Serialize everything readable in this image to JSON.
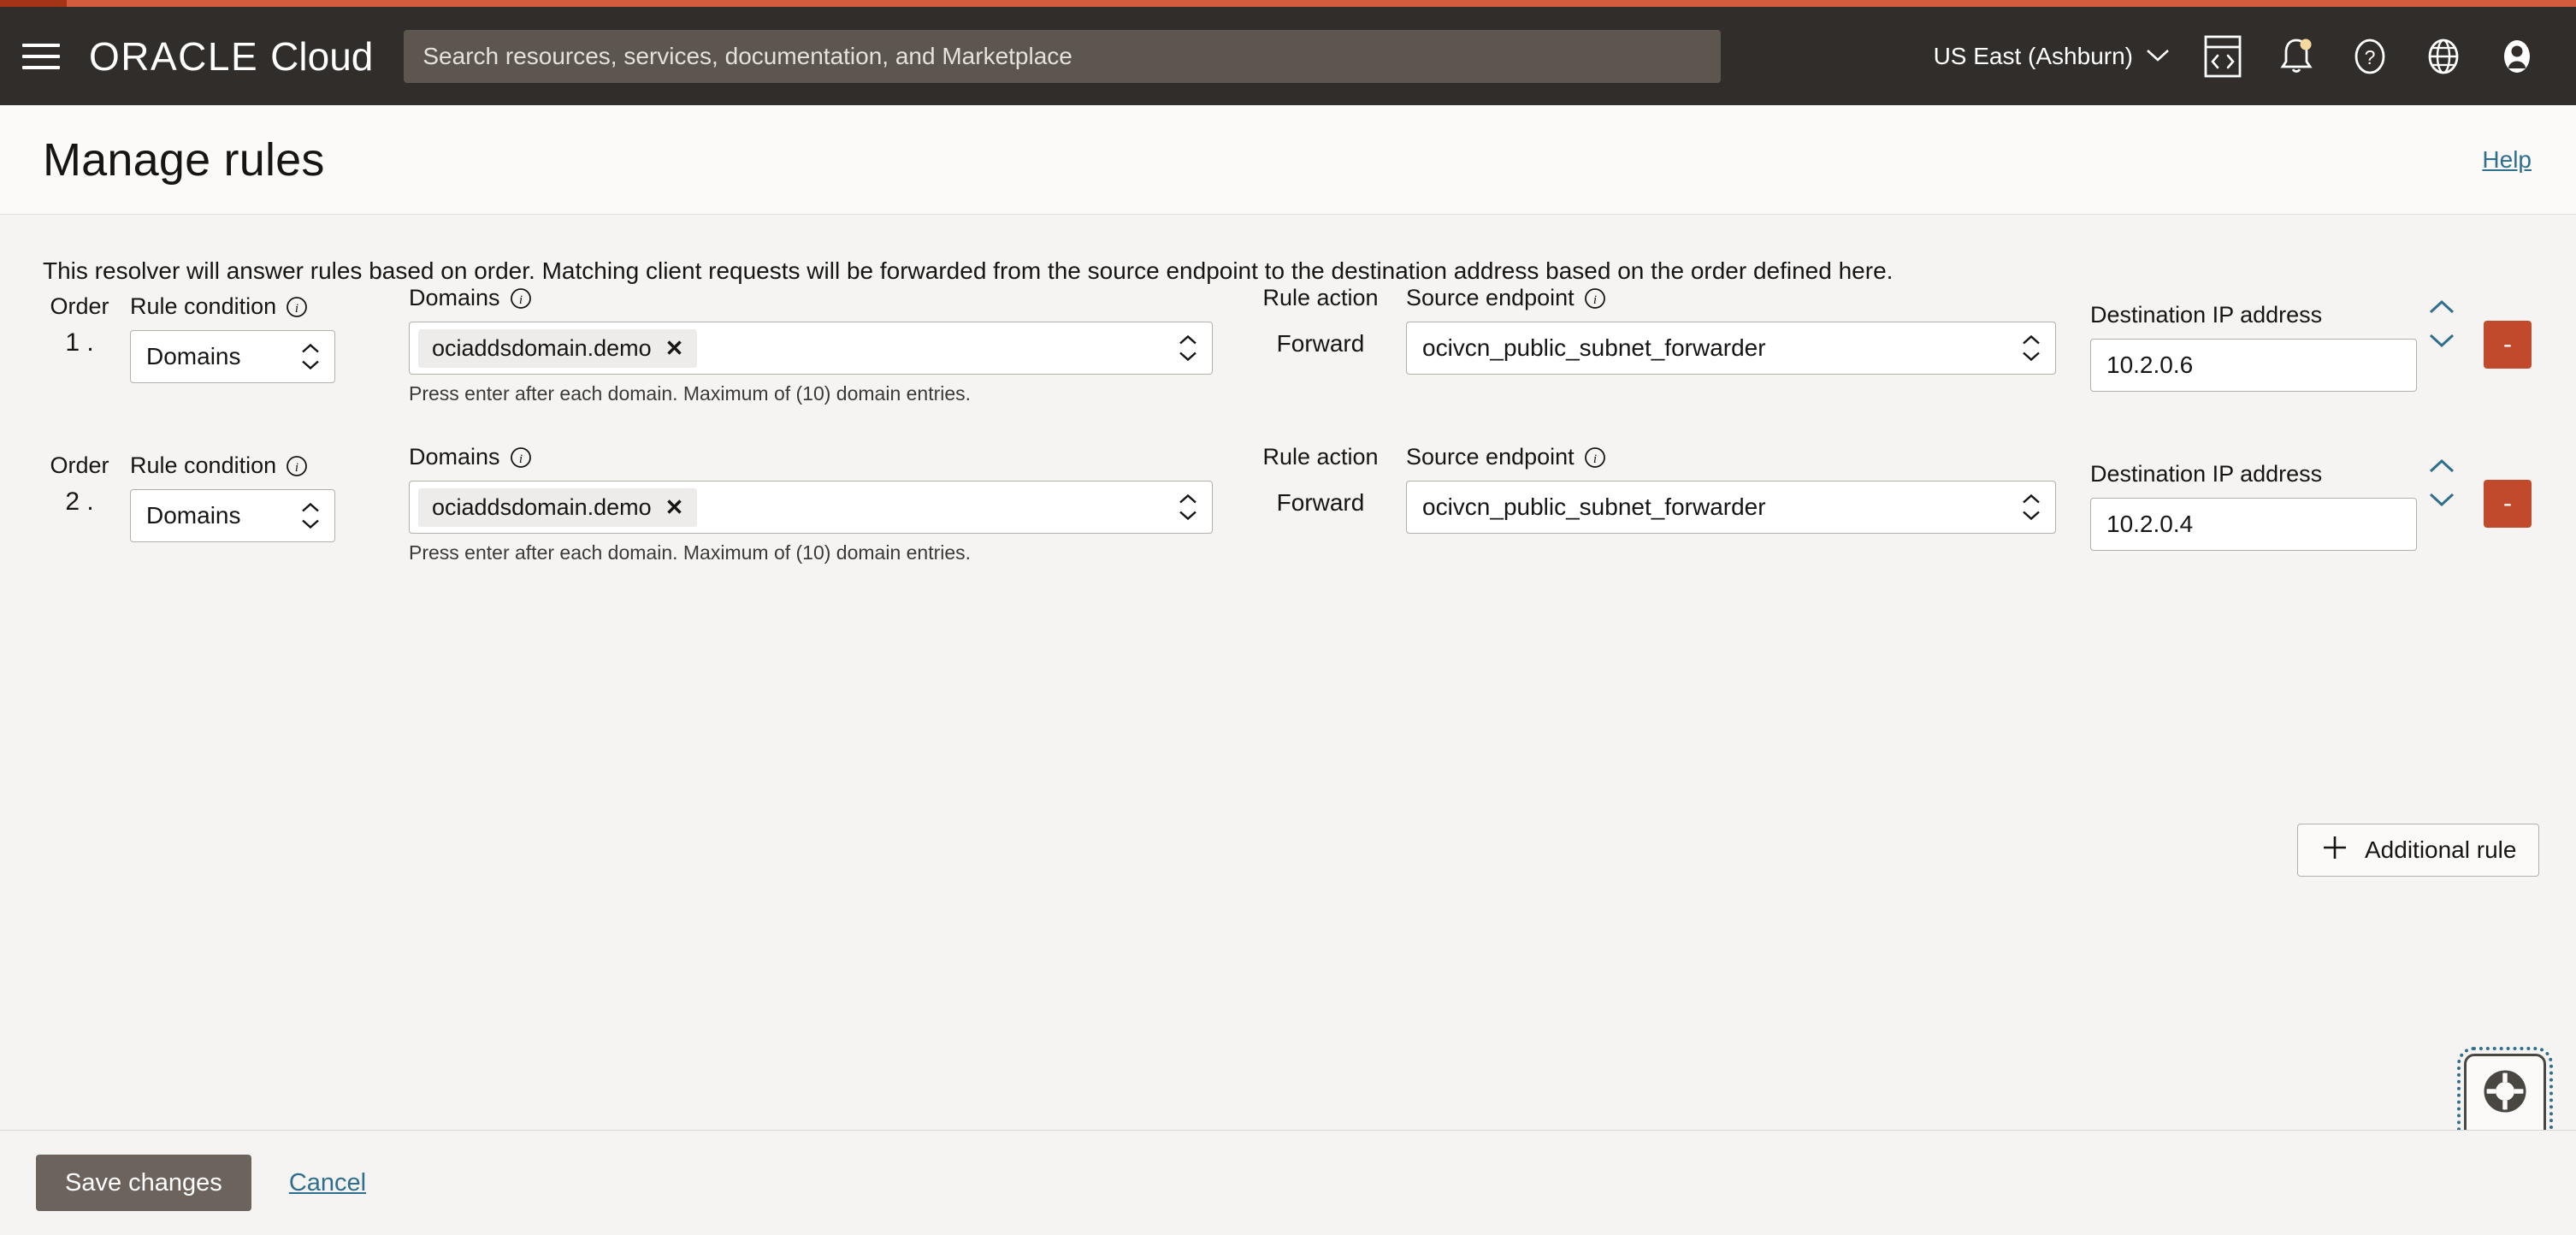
{
  "header": {
    "menu_icon": "hamburger-menu-icon",
    "logo_oracle": "ORACLE",
    "logo_cloud": "Cloud",
    "search_placeholder": "Search resources, services, documentation, and Marketplace",
    "search_value": "",
    "region": "US East (Ashburn)",
    "icons": [
      "cloud-shell-icon",
      "notifications-bell-icon",
      "help-question-icon",
      "language-globe-icon",
      "user-avatar-icon"
    ],
    "accent_color": "#d35c3e"
  },
  "title_bar": {
    "title": "Manage rules",
    "help_label": "Help"
  },
  "content": {
    "intro": "This resolver will answer rules based on order. Matching client requests will be forwarded from the source endpoint to the destination address based on the order defined here.",
    "labels": {
      "order": "Order",
      "rule_condition": "Rule condition",
      "domains": "Domains",
      "rule_action": "Rule action",
      "source_endpoint": "Source endpoint",
      "destination_ip": "Destination IP address",
      "domain_helper": "Press enter after each domain. Maximum of (10) domain entries.",
      "remove_button": "-"
    },
    "rules": [
      {
        "order": "1 .",
        "condition": "Domains",
        "domain_chip": "ociaddsdomain.demo",
        "chip_remove": "✕",
        "action": "Forward",
        "source_endpoint": "ocivcn_public_subnet_forwarder",
        "destination_ip": "10.2.0.6"
      },
      {
        "order": "2 .",
        "condition": "Domains",
        "domain_chip": "ociaddsdomain.demo",
        "chip_remove": "✕",
        "action": "Forward",
        "source_endpoint": "ocivcn_public_subnet_forwarder",
        "destination_ip": "10.2.0.4"
      }
    ],
    "add_rule_label": "Additional rule",
    "add_rule_icon": "plus-icon",
    "support_widget_icon": "lifebuoy-support-icon"
  },
  "footer": {
    "save_label": "Save changes",
    "cancel_label": "Cancel"
  }
}
